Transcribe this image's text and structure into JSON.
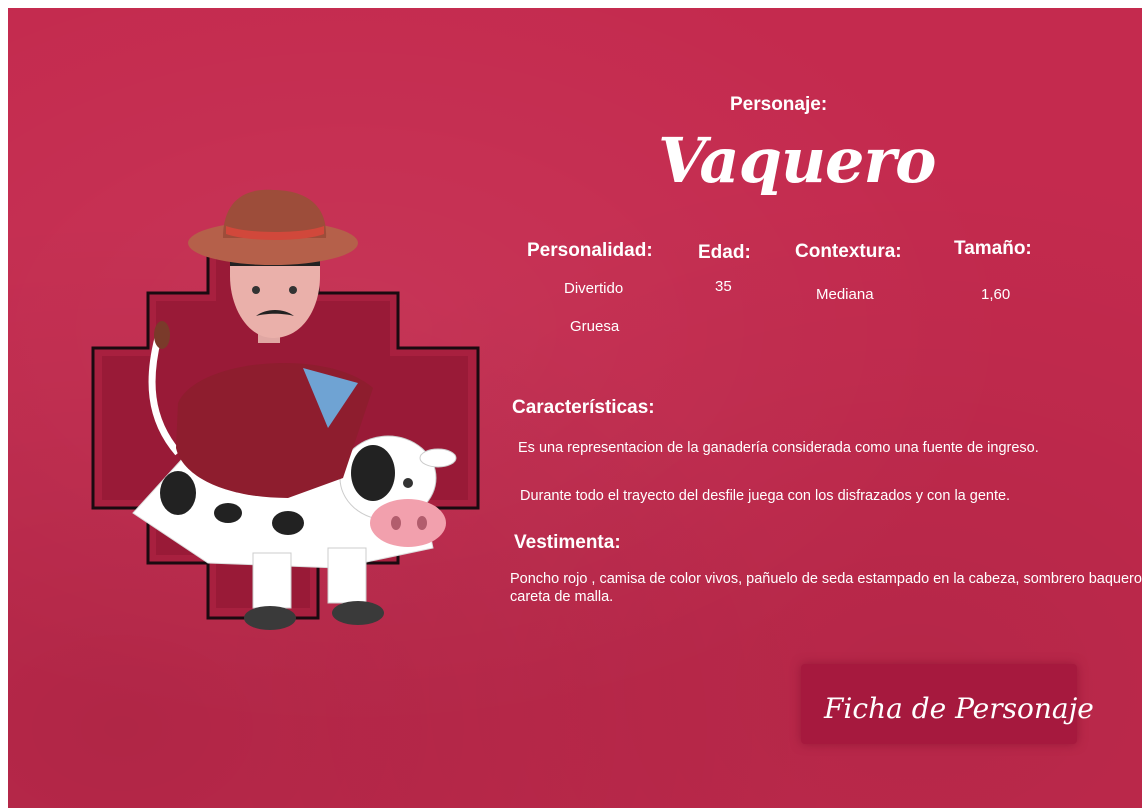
{
  "colors": {
    "background": "#c42a4e",
    "text": "#ffffff",
    "badge": "#a6193e",
    "frame": "#7a1230"
  },
  "header": {
    "personaje_label": "Personaje:",
    "character_name": "Vaquero"
  },
  "attributes": {
    "personalidad": {
      "label": "Personalidad:",
      "values": [
        "Divertido",
        "Gruesa"
      ]
    },
    "edad": {
      "label": "Edad:",
      "value": "35"
    },
    "contextura": {
      "label": "Contextura:",
      "value": "Mediana"
    },
    "tamano": {
      "label": "Tamaño:",
      "value": "1,60"
    }
  },
  "caracteristicas": {
    "label": "Características:",
    "lines": [
      "Es una representacion de la ganadería  considerada como una fuente de ingreso.",
      "Durante todo el trayecto del desfile juega  con los disfrazados y con la gente."
    ]
  },
  "vestimenta": {
    "label": "Vestimenta:",
    "text": "Poncho rojo , camisa de color vivos, pañuelo de seda estampado en la cabeza, sombrero baquero, careta de malla."
  },
  "badge": {
    "text": "Ficha de Personaje"
  },
  "illustration": {
    "subject": "cowboy-riding-cow-character"
  }
}
